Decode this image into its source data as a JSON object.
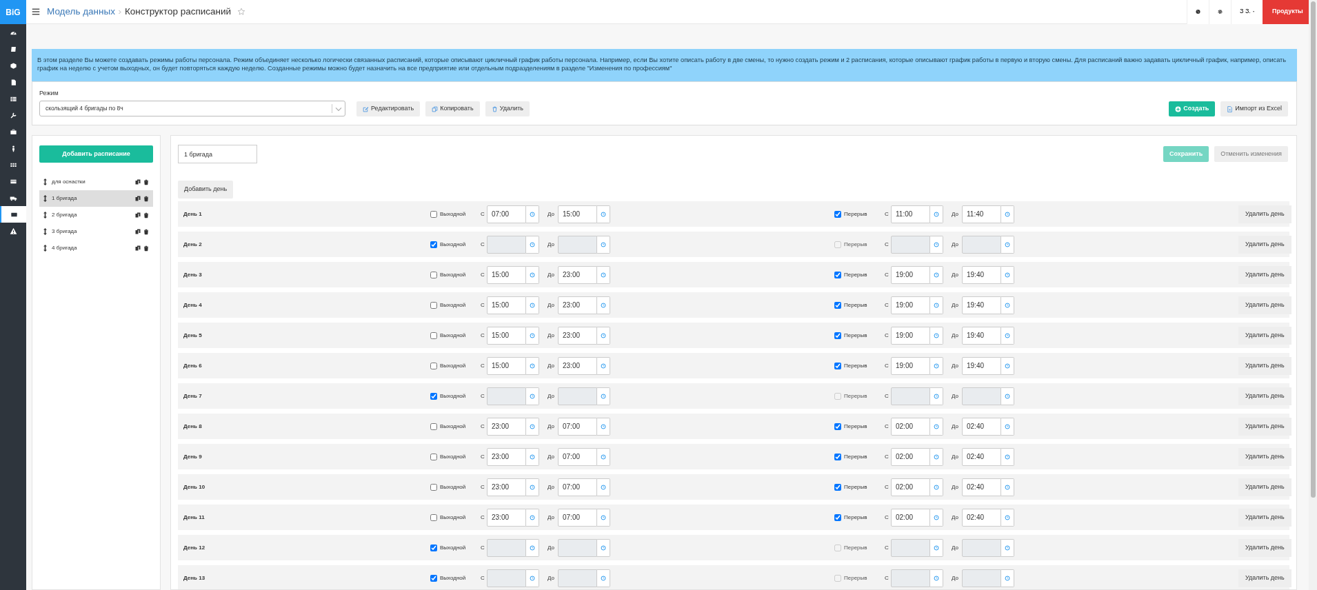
{
  "sidebar": {
    "logo": "BiG",
    "items": [
      {
        "kind": "gauge",
        "selected": false
      },
      {
        "kind": "book",
        "selected": false
      },
      {
        "kind": "cube",
        "selected": false
      },
      {
        "kind": "doc",
        "selected": false
      },
      {
        "kind": "table",
        "selected": false
      },
      {
        "kind": "wrench",
        "selected": false
      },
      {
        "kind": "briefcase",
        "selected": false
      },
      {
        "kind": "person",
        "selected": false
      },
      {
        "kind": "grid",
        "selected": false
      },
      {
        "kind": "card",
        "selected": false
      },
      {
        "kind": "truck",
        "selected": false
      },
      {
        "kind": "card",
        "selected": true
      },
      {
        "kind": "warning",
        "selected": false
      }
    ]
  },
  "topbar": {
    "breadcrumb": "Модель данных",
    "title": "Конструктор расписаний",
    "user": "З З.",
    "products": "Продукты"
  },
  "info": "В этом разделе Вы можете создавать режимы работы персонала. Режим объединяет несколько логически связанных расписаний, которые описывают цикличный график работы персонала. Например, если Вы хотите описать работу в две смены, то нужно создать режим и 2 расписания, которые описывают график работы в первую и вторую смены. Для расписаний важно задавать цикличный график, например, описать график на неделю с учетом выходных, он будет повторяться каждую неделю. Созданные режимы можно будет назначить на все предприятие или отдельным подразделениям в разделе \"Изменения по профессиям\"",
  "mode": {
    "label": "Режим",
    "value": "скользящий 4 бригады по 8ч",
    "edit": "Редактировать",
    "copy": "Копировать",
    "delete": "Удалить",
    "create": "Создать",
    "import": "Импорт из Excel"
  },
  "schedules": {
    "add": "Добавить расписание",
    "items": [
      {
        "name": "для оснастки",
        "selected": false
      },
      {
        "name": "1 бригада",
        "selected": true
      },
      {
        "name": "2 бригада",
        "selected": false
      },
      {
        "name": "3 бригада",
        "selected": false
      },
      {
        "name": "4 бригада",
        "selected": false
      }
    ]
  },
  "editor": {
    "name": "1 бригада",
    "save": "Сохранить",
    "save_disabled": true,
    "cancel": "Отменить изменения",
    "add_day": "Добавить день"
  },
  "days": [
    {
      "label": "День 1",
      "day_off": false,
      "day_off_label": "Выходной",
      "from_label": "С",
      "start": "07:00",
      "to_label": "До",
      "end": "15:00",
      "break": true,
      "break_label": "Перерыв",
      "break_from_label": "С",
      "break_start": "11:00",
      "break_to_label": "До",
      "break_end": "11:40",
      "delete": "Удалить день"
    },
    {
      "label": "День 2",
      "day_off": true,
      "day_off_label": "Выходной",
      "from_label": "С",
      "to_label": "До",
      "break": false,
      "break_label": "Перерыв",
      "break_from_label": "С",
      "break_to_label": "До",
      "delete": "Удалить день"
    },
    {
      "label": "День 3",
      "day_off": false,
      "day_off_label": "Выходной",
      "from_label": "С",
      "start": "15:00",
      "to_label": "До",
      "end": "23:00",
      "break": true,
      "break_label": "Перерыв",
      "break_from_label": "С",
      "break_start": "19:00",
      "break_to_label": "До",
      "break_end": "19:40",
      "delete": "Удалить день"
    },
    {
      "label": "День 4",
      "day_off": false,
      "day_off_label": "Выходной",
      "from_label": "С",
      "start": "15:00",
      "to_label": "До",
      "end": "23:00",
      "break": true,
      "break_label": "Перерыв",
      "break_from_label": "С",
      "break_start": "19:00",
      "break_to_label": "До",
      "break_end": "19:40",
      "delete": "Удалить день"
    },
    {
      "label": "День 5",
      "day_off": false,
      "day_off_label": "Выходной",
      "from_label": "С",
      "start": "15:00",
      "to_label": "До",
      "end": "23:00",
      "break": true,
      "break_label": "Перерыв",
      "break_from_label": "С",
      "break_start": "19:00",
      "break_to_label": "До",
      "break_end": "19:40",
      "delete": "Удалить день"
    },
    {
      "label": "День 6",
      "day_off": false,
      "day_off_label": "Выходной",
      "from_label": "С",
      "start": "15:00",
      "to_label": "До",
      "end": "23:00",
      "break": true,
      "break_label": "Перерыв",
      "break_from_label": "С",
      "break_start": "19:00",
      "break_to_label": "До",
      "break_end": "19:40",
      "delete": "Удалить день"
    },
    {
      "label": "День 7",
      "day_off": true,
      "day_off_label": "Выходной",
      "from_label": "С",
      "to_label": "До",
      "break": false,
      "break_label": "Перерыв",
      "break_from_label": "С",
      "break_to_label": "До",
      "delete": "Удалить день"
    },
    {
      "label": "День 8",
      "day_off": false,
      "day_off_label": "Выходной",
      "from_label": "С",
      "start": "23:00",
      "to_label": "До",
      "end": "07:00",
      "break": true,
      "break_label": "Перерыв",
      "break_from_label": "С",
      "break_start": "02:00",
      "break_to_label": "До",
      "break_end": "02:40",
      "delete": "Удалить день"
    },
    {
      "label": "День 9",
      "day_off": false,
      "day_off_label": "Выходной",
      "from_label": "С",
      "start": "23:00",
      "to_label": "До",
      "end": "07:00",
      "break": true,
      "break_label": "Перерыв",
      "break_from_label": "С",
      "break_start": "02:00",
      "break_to_label": "До",
      "break_end": "02:40",
      "delete": "Удалить день"
    },
    {
      "label": "День 10",
      "day_off": false,
      "day_off_label": "Выходной",
      "from_label": "С",
      "start": "23:00",
      "to_label": "До",
      "end": "07:00",
      "break": true,
      "break_label": "Перерыв",
      "break_from_label": "С",
      "break_start": "02:00",
      "break_to_label": "До",
      "break_end": "02:40",
      "delete": "Удалить день"
    },
    {
      "label": "День 11",
      "day_off": false,
      "day_off_label": "Выходной",
      "from_label": "С",
      "start": "23:00",
      "to_label": "До",
      "end": "07:00",
      "break": true,
      "break_label": "Перерыв",
      "break_from_label": "С",
      "break_start": "02:00",
      "break_to_label": "До",
      "break_end": "02:40",
      "delete": "Удалить день"
    },
    {
      "label": "День 12",
      "day_off": true,
      "day_off_label": "Выходной",
      "from_label": "С",
      "to_label": "До",
      "break": false,
      "break_label": "Перерыв",
      "break_from_label": "С",
      "break_to_label": "До",
      "delete": "Удалить день"
    },
    {
      "label": "День 13",
      "day_off": true,
      "day_off_label": "Выходной",
      "from_label": "С",
      "to_label": "До",
      "break": false,
      "break_label": "Перерыв",
      "break_from_label": "С",
      "break_to_label": "До",
      "delete": "Удалить день"
    }
  ]
}
